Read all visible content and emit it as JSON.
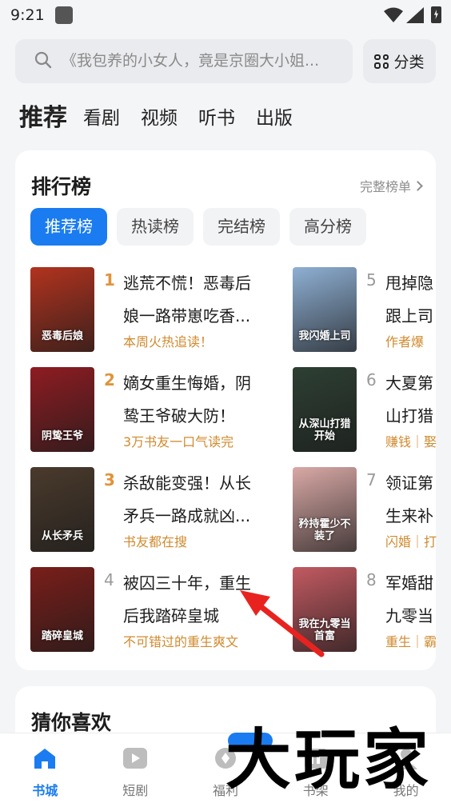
{
  "status": {
    "time": "9:21"
  },
  "search": {
    "placeholder": "《我包养的小女人，竟是京圈大小姐...",
    "category_label": "分类"
  },
  "top_tabs": [
    "推荐",
    "看剧",
    "视频",
    "听书",
    "出版"
  ],
  "ranking": {
    "title": "排行榜",
    "full_list_label": "完整榜单",
    "tabs": [
      "推荐榜",
      "热读榜",
      "完结榜",
      "高分榜"
    ],
    "books": [
      {
        "rank": "1",
        "title_line1": "逃荒不慌！恶毒后",
        "title_line2": "娘一路带崽吃香...",
        "tag": "本周火热追读！",
        "cover_text": "恶毒后娘",
        "cover_color": "#b2331f"
      },
      {
        "rank": "2",
        "title_line1": "嫡女重生悔婚，阴",
        "title_line2": "鸷王爷破大防！",
        "tag": "3万书友一口气读完",
        "cover_text": "阴鸷王爷",
        "cover_color": "#8e1c22"
      },
      {
        "rank": "3",
        "title_line1": "杀敌能变强！从长",
        "title_line2": "矛兵一路成就凶...",
        "tag": "书友都在搜",
        "cover_text": "从长矛兵",
        "cover_color": "#4a3a2c"
      },
      {
        "rank": "4",
        "title_line1": "被囚三十年，重生",
        "title_line2": "后我踏碎皇城",
        "tag": "不可错过的重生爽文",
        "cover_text": "踏碎皇城",
        "cover_color": "#7a1e1a"
      },
      {
        "rank": "5",
        "title_line1": "甩掉隐",
        "title_line2": "跟上司",
        "tag": "作者爆",
        "cover_text": "我闪婚上司",
        "cover_color": "#8fb0d4"
      },
      {
        "rank": "6",
        "title_line1": "大夏第",
        "title_line2": "山打猎",
        "tag": "赚钱｜娶",
        "cover_text": "从深山打猎开始",
        "cover_color": "#2d3f33"
      },
      {
        "rank": "7",
        "title_line1": "领证第",
        "title_line2": "生来补",
        "tag": "闪婚｜打",
        "cover_text": "矜持霍少不装了",
        "cover_color": "#d9a9a6"
      },
      {
        "rank": "8",
        "title_line1": "军婚甜",
        "title_line2": "九零当",
        "tag": "重生｜霸",
        "cover_text": "我在九零当首富",
        "cover_color": "#c25a61"
      }
    ]
  },
  "guess": {
    "title": "猜你喜欢"
  },
  "bottom_nav": [
    {
      "label": "书城",
      "icon": "home-icon",
      "active": true
    },
    {
      "label": "短剧",
      "icon": "play-icon",
      "active": false
    },
    {
      "label": "福利",
      "icon": "gift-icon",
      "active": false
    },
    {
      "label": "书架",
      "icon": "bookshelf-icon",
      "active": false
    },
    {
      "label": "我的",
      "icon": "profile-icon",
      "active": false
    }
  ],
  "watermark": "大玩家",
  "colors": {
    "accent": "#1a7cf0",
    "tag": "#d08a2e",
    "rank_top": "#e0933a",
    "rank_other": "#9a9a9a"
  }
}
